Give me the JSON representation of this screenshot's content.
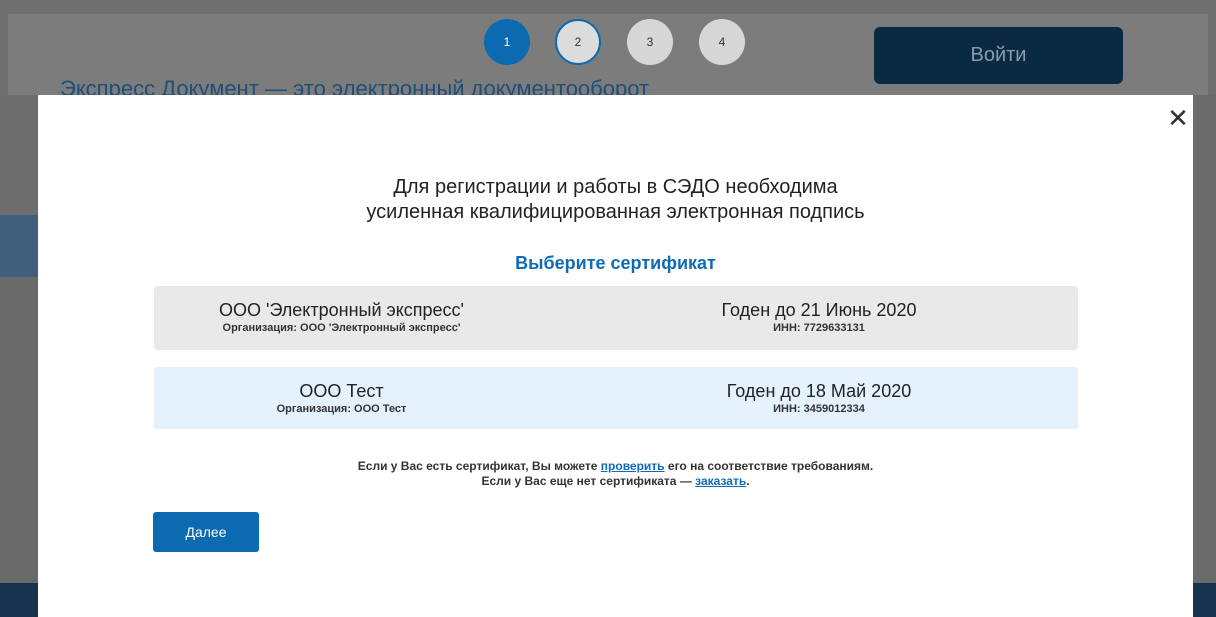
{
  "background": {
    "title": "Экспресс Документ — это электронный документооборот",
    "login_button": "Войти",
    "steps": [
      "1",
      "2",
      "3",
      "4"
    ]
  },
  "modal": {
    "close_icon": "close-icon",
    "headline_line1": "Для регистрации и работы в СЭДО необходима",
    "headline_line2": "усиленная квалифицированная электронная подпись",
    "choose_label": "Выберите сертификат",
    "certificates": [
      {
        "name": "ООО 'Электронный экспресс'",
        "organization": "Организация: ООО 'Электронный экспресс'",
        "valid_until": "Годен до 21 Июнь 2020",
        "inn": "ИНН: 7729633131"
      },
      {
        "name": "ООО Тест",
        "organization": "Организация: ООО Тест",
        "valid_until": "Годен до 18 Май 2020",
        "inn": "ИНН: 3459012334"
      }
    ],
    "note": {
      "line1_before": "Если у Вас есть сертификат, Вы можете ",
      "line1_link": "проверить",
      "line1_after": " его на соответствие требованиям.",
      "line2_before": "Если у Вас еще нет сертификата — ",
      "line2_link": "заказать",
      "line2_after": "."
    },
    "next_button": "Далее"
  },
  "colors": {
    "accent": "#0c6ab0",
    "selected_row": "#e4f2fd",
    "row": "#e9e9e9",
    "overlay": "#6f6f6f",
    "login_button": "#0a2a44"
  }
}
